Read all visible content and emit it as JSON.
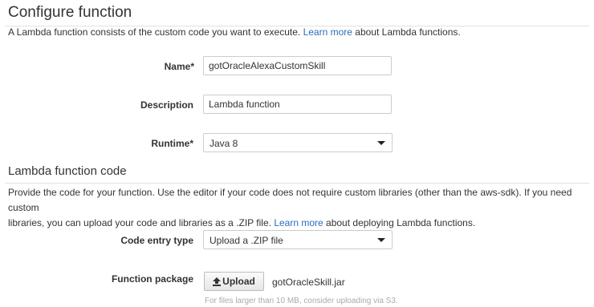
{
  "configure": {
    "title": "Configure function",
    "description": {
      "before": "A Lambda function consists of the custom code you want to execute.",
      "link": "Learn more",
      "after": "about Lambda functions."
    },
    "name": {
      "label": "Name*",
      "value": "gotOracleAlexaCustomSkill"
    },
    "description_field": {
      "label": "Description",
      "value": "Lambda function"
    },
    "runtime": {
      "label": "Runtime*",
      "selected": "Java 8"
    }
  },
  "code": {
    "title": "Lambda function code",
    "description": {
      "line1": "Provide the code for your function. Use the editor if your code does not require custom libraries (other than the aws-sdk). If you need custom",
      "line2_before": "libraries, you can upload your code and libraries as a .ZIP file.",
      "link": "Learn more",
      "line2_after": "about deploying Lambda functions."
    },
    "entry_type": {
      "label": "Code entry type",
      "selected": "Upload a .ZIP file"
    },
    "package": {
      "label": "Function package",
      "button_label": "Upload",
      "file_name": "gotOracleSkill.jar",
      "hint": "For files larger than 10 MB, consider uploading via S3."
    }
  },
  "icons": {
    "upload": "upload-arrow-icon",
    "dropdown": "caret-down-icon"
  },
  "colors": {
    "link": "#2a6ebb",
    "text": "#333333",
    "hint": "#aaaaaa",
    "border": "#cccccc"
  }
}
